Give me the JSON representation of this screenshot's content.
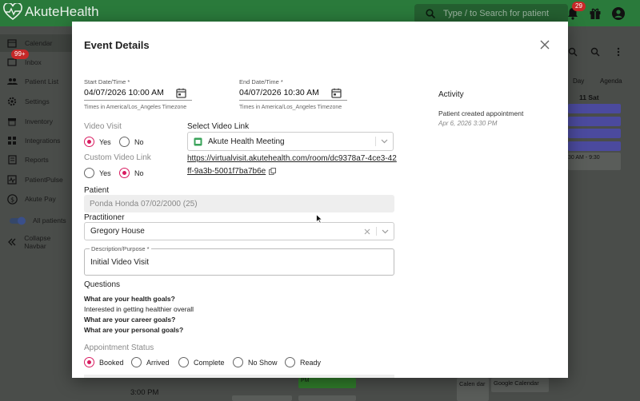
{
  "app": {
    "brand": "AkuteHealth",
    "search_placeholder": "Type / to Search for patient",
    "notification_count": "29",
    "inbox_badge": "99+"
  },
  "sidebar": {
    "items": [
      {
        "label": "Calendar",
        "icon": "calendar-icon"
      },
      {
        "label": "Inbox",
        "icon": "inbox-icon"
      },
      {
        "label": "Patient List",
        "icon": "people-icon"
      },
      {
        "label": "Settings",
        "icon": "gear-icon"
      },
      {
        "label": "Inventory",
        "icon": "inventory-icon"
      },
      {
        "label": "Integrations",
        "icon": "integrations-icon"
      },
      {
        "label": "Reports",
        "icon": "reports-icon"
      },
      {
        "label": "PatientPulse",
        "icon": "pulse-icon"
      },
      {
        "label": "Akute Pay",
        "icon": "dollar-icon"
      },
      {
        "label": "All patients",
        "icon": "toggle-icon"
      },
      {
        "label": "Collapse Navbar",
        "icon": "chevrons-left-icon"
      }
    ]
  },
  "calendar_bg": {
    "view_day": "Day",
    "view_agenda": "Agenda",
    "day_header": "11 Sat",
    "event_time": "30 AM - 9:30",
    "time_label": "3:00 PM",
    "bottom_labels": [
      "Google Calendar",
      "PM",
      "Calen dar",
      "Google Calendar"
    ]
  },
  "modal": {
    "title": "Event Details",
    "start_label": "Start Date/Time *",
    "start_value": "04/07/2026 10:00 AM",
    "end_label": "End Date/Time *",
    "end_value": "04/07/2026 10:30 AM",
    "timezone_note": "Times in America/Los_Angeles Timezone",
    "video_visit_label": "Video Visit",
    "video_visit_yes": "Yes",
    "video_visit_no": "No",
    "video_visit_selected": "Yes",
    "select_video_link_label": "Select Video Link",
    "video_link_value": "Akute Health Meeting",
    "custom_video_label": "Custom Video Link",
    "custom_video_yes": "Yes",
    "custom_video_no": "No",
    "custom_video_selected": "No",
    "video_url": "https://virtualvisit.akutehealth.com/room/dc9378a7-4ce3-42ff-9a3b-5001f7ba7b6e",
    "patient_label": "Patient",
    "patient_value": "Ponda Honda 07/02/2000 (25)",
    "practitioner_label": "Practitioner",
    "practitioner_value": "Gregory House",
    "description_label": "Description/Purpose *",
    "description_value": "Initial Video Visit",
    "questions_label": "Questions",
    "questions": [
      {
        "text": "What are your health goals?",
        "bold": true
      },
      {
        "text": "Interested in getting healthier overall",
        "bold": false
      },
      {
        "text": "What are your career goals?",
        "bold": true
      },
      {
        "text": "What are your personal goals?",
        "bold": true
      }
    ],
    "status_label": "Appointment Status",
    "statuses": [
      "Booked",
      "Arrived",
      "Complete",
      "No Show",
      "Ready"
    ],
    "status_selected": "Booked",
    "activity_title": "Activity",
    "activity_entry": "Patient created appointment",
    "activity_date": "Apr 6, 2026 3:30 PM"
  },
  "colors": {
    "brand_green": "#2a7a3b",
    "radio_accent": "#d81b60",
    "event_purple": "#4b4a9e"
  }
}
